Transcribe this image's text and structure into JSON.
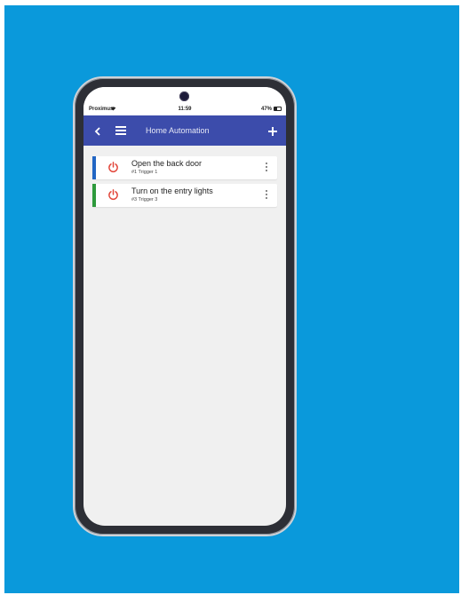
{
  "status_bar": {
    "carrier": "Proximus",
    "time": "11:59",
    "battery": "47%"
  },
  "header": {
    "title": "Home Automation",
    "back_icon": "chevron-left-icon",
    "menu_icon": "hamburger-menu-icon",
    "add_icon": "plus-icon",
    "color": "#3c4cab"
  },
  "automations": [
    {
      "title": "Open the back door",
      "subtitle": "#1 Trigger 1",
      "accent": "#2266c4",
      "icon": "power-icon"
    },
    {
      "title": "Turn on the entry lights",
      "subtitle": "#3 Trigger 3",
      "accent": "#2e9a3c",
      "icon": "power-icon"
    }
  ],
  "colors": {
    "background": "#0a99db",
    "power_icon": "#e2463a"
  }
}
